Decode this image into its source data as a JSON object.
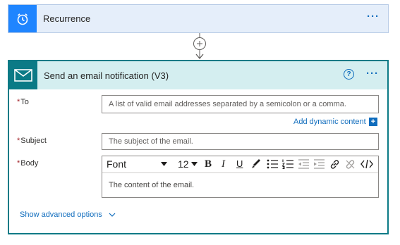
{
  "recurrence": {
    "title": "Recurrence",
    "icon": "alarm-clock-icon",
    "more": "···"
  },
  "connector": {
    "icon": "add-step-icon"
  },
  "email": {
    "title": "Send an email notification (V3)",
    "help": "?",
    "more": "···",
    "to": {
      "label": "To",
      "placeholder": "A list of valid email addresses separated by a semicolon or a comma."
    },
    "add_dynamic": "Add dynamic content",
    "add_dynamic_icon": "+",
    "subject": {
      "label": "Subject",
      "placeholder": "The subject of the email."
    },
    "body": {
      "label": "Body",
      "font": "Font",
      "size": "12",
      "bold": "B",
      "italic": "I",
      "underline": "U",
      "placeholder": "The content of the email."
    },
    "advanced": "Show advanced options"
  },
  "colors": {
    "recurrence_accent": "#1f85ff",
    "email_accent": "#0b7a86",
    "link": "#0f6cbd"
  }
}
